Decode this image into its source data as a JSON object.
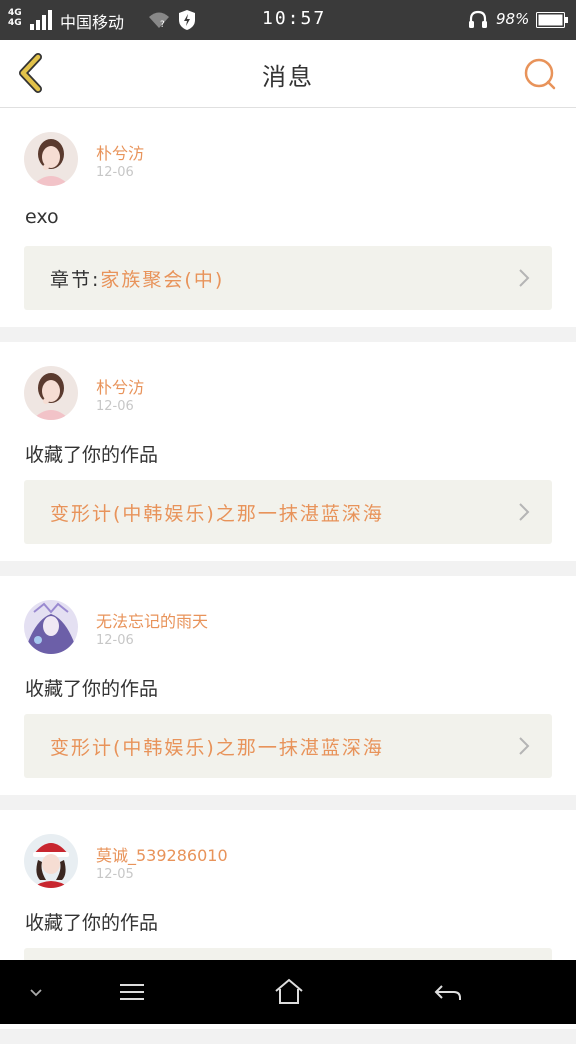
{
  "status_bar": {
    "network": "4G 4G",
    "carrier": "中国移动",
    "time": "10:57",
    "battery_percent": "98%"
  },
  "header": {
    "title": "消息",
    "back_icon": "chevron-left-icon",
    "search_icon": "search-icon"
  },
  "colors": {
    "accent": "#e8935a",
    "back_icon": "#e2c24a",
    "link_bg": "#f2f2ec"
  },
  "messages": [
    {
      "username": "朴兮汸",
      "date": "12-06",
      "text": "exo",
      "link_prefix": "章节:",
      "link": "家族聚会(中)"
    },
    {
      "username": "朴兮汸",
      "date": "12-06",
      "text": "收藏了你的作品",
      "link_prefix": "",
      "link": "变形计(中韩娱乐)之那一抹湛蓝深海"
    },
    {
      "username": "无法忘记的雨天",
      "date": "12-06",
      "text": "收藏了你的作品",
      "link_prefix": "",
      "link": "变形计(中韩娱乐)之那一抹湛蓝深海"
    },
    {
      "username": "莫诚_539286010",
      "date": "12-05",
      "text": "收藏了你的作品",
      "link_prefix": "",
      "link": ""
    }
  ],
  "nav_bar": {
    "icons": [
      "chevron-down-icon",
      "menu-icon",
      "home-icon",
      "back-arrow-icon"
    ]
  }
}
